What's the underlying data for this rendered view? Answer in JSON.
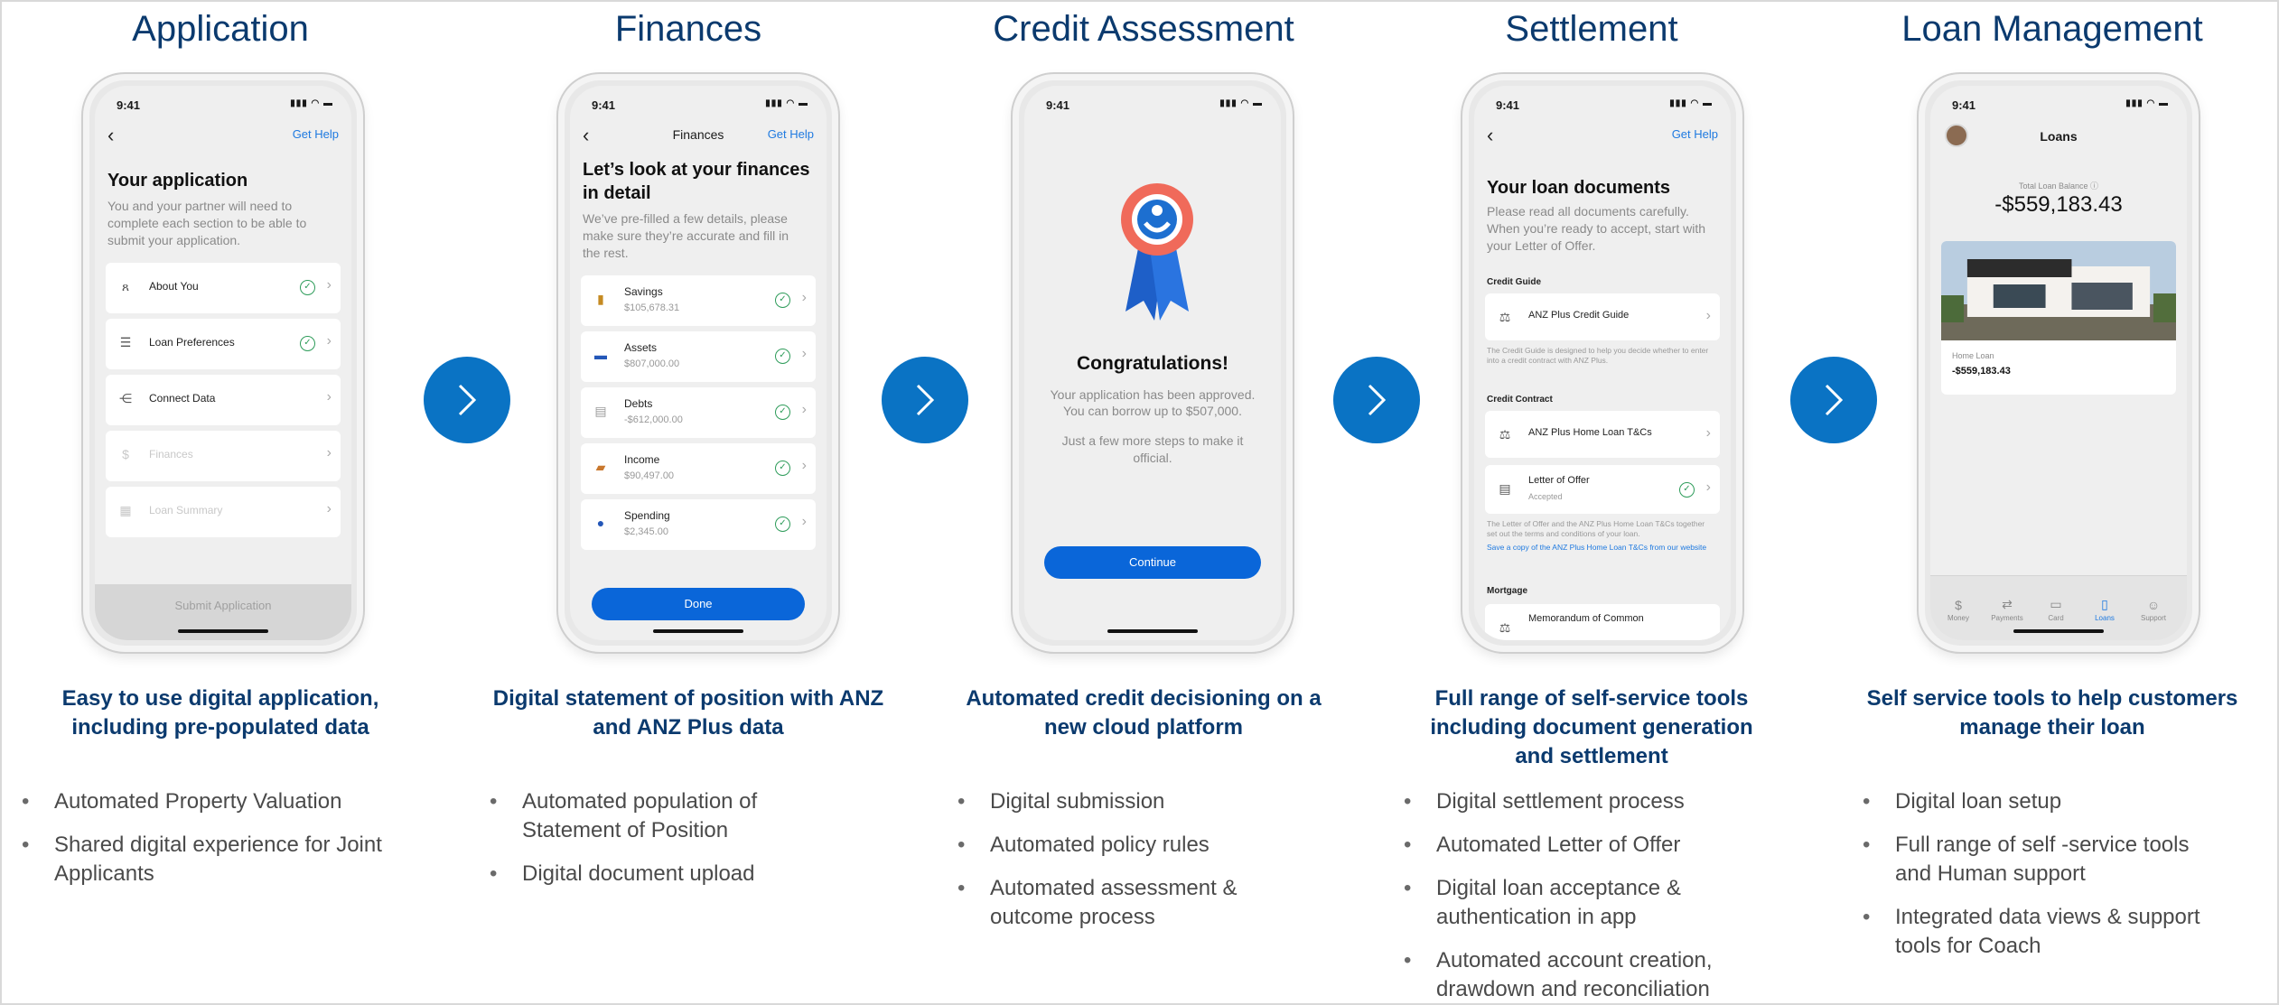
{
  "columns": [
    {
      "title": "Application",
      "caption": "Easy to use digital application, including pre-populated data",
      "bullets": [
        "Automated Property Valuation",
        "Shared digital experience for Joint Applicants"
      ],
      "phone": {
        "time": "9:41",
        "get_help": "Get Help",
        "heading": "Your application",
        "subtext": "You and your partner will need to complete each section to be able to submit your application.",
        "rows": [
          {
            "label": "About You",
            "icon": "people-icon",
            "glyph": "ጸ",
            "done": true
          },
          {
            "label": "Loan Preferences",
            "icon": "sliders-icon",
            "glyph": "☰",
            "done": true
          },
          {
            "label": "Connect Data",
            "icon": "share-icon",
            "glyph": "⋲",
            "done": false
          },
          {
            "label": "Finances",
            "icon": "dollar-icon",
            "glyph": "$",
            "done": false
          },
          {
            "label": "Loan Summary",
            "icon": "calendar-icon",
            "glyph": "▦",
            "done": false
          }
        ],
        "submit": "Submit Application"
      }
    },
    {
      "title": "Finances",
      "caption": "Digital statement of position with ANZ and ANZ Plus data",
      "bullets": [
        "Automated population of Statement of Position",
        "Digital document upload"
      ],
      "phone": {
        "time": "9:41",
        "nav_title": "Finances",
        "get_help": "Get Help",
        "heading": "Let’s look at your finances in detail",
        "subtext": "We’ve pre-filled a few details, please make sure they’re accurate and fill in the rest.",
        "rows": [
          {
            "label": "Savings",
            "value": "$105,678.31",
            "icon": "jar-icon",
            "glyph": "▮"
          },
          {
            "label": "Assets",
            "value": "$807,000.00",
            "icon": "car-icon",
            "glyph": "▬"
          },
          {
            "label": "Debts",
            "value": "-$612,000.00",
            "icon": "document-icon",
            "glyph": "▤"
          },
          {
            "label": "Income",
            "value": "$90,497.00",
            "icon": "briefcase-icon",
            "glyph": "▰"
          },
          {
            "label": "Spending",
            "value": "$2,345.00",
            "icon": "card-icon",
            "glyph": "●"
          }
        ],
        "done": "Done"
      }
    },
    {
      "title": "Credit Assessment",
      "caption": "Automated credit decisioning on a new cloud platform",
      "bullets": [
        "Digital submission",
        "Automated policy rules",
        "Automated assessment & outcome process"
      ],
      "phone": {
        "time": "9:41",
        "heading": "Congratulations!",
        "line1": "Your application has been approved.",
        "line2": "You can borrow up to $507,000.",
        "line3": "Just a few more steps to make it official.",
        "continue": "Continue"
      }
    },
    {
      "title": "Settlement",
      "caption": "Full range of self-service tools including document generation and settlement",
      "bullets": [
        "Digital settlement process",
        "Automated Letter of Offer",
        "Digital loan acceptance & authentication in app",
        "Automated account creation, drawdown and reconciliation"
      ],
      "phone": {
        "time": "9:41",
        "get_help": "Get Help",
        "heading": "Your loan documents",
        "subtext": "Please read all documents carefully. When you’re ready to accept, start with your Letter of Offer.",
        "credit_guide_label": "Credit Guide",
        "credit_guide_item": "ANZ Plus Credit Guide",
        "credit_guide_note": "The Credit Guide is designed to help you decide whether to enter into a credit contract with ANZ Plus.",
        "credit_contract_label": "Credit Contract",
        "tcs_item": "ANZ Plus Home Loan T&Cs",
        "offer_item": "Letter of Offer",
        "offer_status": "Accepted",
        "contract_note": "The Letter of Offer and the ANZ Plus Home Loan T&Cs together set out the terms and conditions of your loan.",
        "save_link": "Save a copy of the ANZ Plus Home Loan T&Cs from our website",
        "mortgage_label": "Mortgage",
        "mortgage_item": "Memorandum of Common"
      }
    },
    {
      "title": "Loan Management",
      "caption": "Self service tools to help customers manage their loan",
      "bullets": [
        "Digital loan setup",
        "Full range of self -service tools and Human support",
        "Integrated data views & support tools for Coach"
      ],
      "phone": {
        "time": "9:41",
        "nav_title": "Loans",
        "balance_label": "Total Loan Balance ⓘ",
        "balance": "-$559,183.43",
        "card_label": "Home Loan",
        "card_value": "-$559,183.43",
        "tabs": [
          {
            "label": "Money",
            "glyph": "$",
            "active": false
          },
          {
            "label": "Payments",
            "glyph": "⇄",
            "active": false
          },
          {
            "label": "Card",
            "glyph": "▭",
            "active": false
          },
          {
            "label": "Loans",
            "glyph": "▯",
            "active": true
          },
          {
            "label": "Support",
            "glyph": "☺",
            "active": false
          }
        ]
      }
    }
  ],
  "colors": {
    "brand_title": "#0b3a6e",
    "arrow": "#0a73c4",
    "button": "#0a66d9",
    "check": "#2e9c5a",
    "link": "#1f7ae0"
  }
}
